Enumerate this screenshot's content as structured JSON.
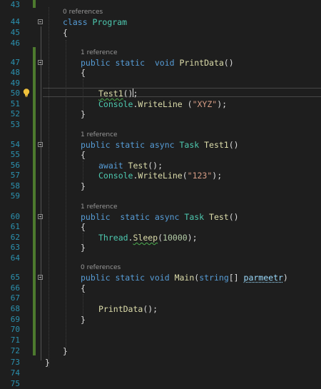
{
  "editor": {
    "colors": {
      "keyword": "#569cd6",
      "type": "#4ec9b0",
      "method": "#dcdcaa",
      "string": "#d69d85",
      "number": "#b5cea8",
      "parameter": "#9cdcfe",
      "line_number": "#2b91af",
      "change_bar": "#4d7a2e"
    },
    "code_lens": {
      "program": "0 references",
      "printdata": "1 reference",
      "test1": "1 reference",
      "test": "1 reference",
      "main": "0 references"
    },
    "lines": [
      {
        "num": "43",
        "tokens": []
      },
      {
        "num": "44",
        "tokens": [
          [
            "kw",
            "class "
          ],
          [
            "type",
            "Program"
          ]
        ]
      },
      {
        "num": "45",
        "tokens": [
          [
            "plain",
            "{"
          ]
        ]
      },
      {
        "num": "46",
        "tokens": []
      },
      {
        "num": "47",
        "tokens": [
          [
            "kw",
            "public static  void "
          ],
          [
            "method",
            "PrintData"
          ],
          [
            "plain",
            "()"
          ]
        ]
      },
      {
        "num": "48",
        "tokens": [
          [
            "plain",
            "{"
          ]
        ]
      },
      {
        "num": "49",
        "tokens": []
      },
      {
        "num": "50",
        "tokens": [
          [
            "method",
            "Test1"
          ],
          [
            "plain",
            "();"
          ]
        ]
      },
      {
        "num": "51",
        "tokens": [
          [
            "type",
            "Console"
          ],
          [
            "plain",
            "."
          ],
          [
            "method",
            "WriteLine"
          ],
          [
            "plain",
            " ("
          ],
          [
            "str",
            "\"XYZ\""
          ],
          [
            "plain",
            ");"
          ]
        ]
      },
      {
        "num": "52",
        "tokens": [
          [
            "plain",
            "}"
          ]
        ]
      },
      {
        "num": "53",
        "tokens": []
      },
      {
        "num": "54",
        "tokens": [
          [
            "kw",
            "public static async "
          ],
          [
            "type",
            "Task "
          ],
          [
            "method",
            "Test1"
          ],
          [
            "plain",
            "()"
          ]
        ]
      },
      {
        "num": "55",
        "tokens": [
          [
            "plain",
            "{"
          ]
        ]
      },
      {
        "num": "56",
        "tokens": [
          [
            "kw",
            "await "
          ],
          [
            "method",
            "Test"
          ],
          [
            "plain",
            "();"
          ]
        ]
      },
      {
        "num": "57",
        "tokens": [
          [
            "type",
            "Console"
          ],
          [
            "plain",
            "."
          ],
          [
            "method",
            "WriteLine"
          ],
          [
            "plain",
            "("
          ],
          [
            "str",
            "\"123\""
          ],
          [
            "plain",
            ");"
          ]
        ]
      },
      {
        "num": "58",
        "tokens": [
          [
            "plain",
            "}"
          ]
        ]
      },
      {
        "num": "59",
        "tokens": []
      },
      {
        "num": "60",
        "tokens": [
          [
            "kw",
            "public  static async "
          ],
          [
            "type",
            "Task "
          ],
          [
            "method",
            "Test"
          ],
          [
            "plain",
            "()"
          ]
        ]
      },
      {
        "num": "61",
        "tokens": [
          [
            "plain",
            "{"
          ]
        ]
      },
      {
        "num": "62",
        "tokens": [
          [
            "type",
            "Thread"
          ],
          [
            "plain",
            "."
          ],
          [
            "method",
            "Sleep"
          ],
          [
            "plain",
            "("
          ],
          [
            "num",
            "10000"
          ],
          [
            "plain",
            ");"
          ]
        ]
      },
      {
        "num": "63",
        "tokens": [
          [
            "plain",
            "}"
          ]
        ]
      },
      {
        "num": "64",
        "tokens": []
      },
      {
        "num": "65",
        "tokens": [
          [
            "kw",
            "public static void "
          ],
          [
            "method",
            "Main"
          ],
          [
            "plain",
            "("
          ],
          [
            "kw",
            "string"
          ],
          [
            "plain",
            "[] "
          ],
          [
            "param",
            "parmeetr"
          ],
          [
            "plain",
            ")"
          ]
        ]
      },
      {
        "num": "66",
        "tokens": [
          [
            "plain",
            "{"
          ]
        ]
      },
      {
        "num": "67",
        "tokens": []
      },
      {
        "num": "68",
        "tokens": [
          [
            "method",
            "PrintData"
          ],
          [
            "plain",
            "();"
          ]
        ]
      },
      {
        "num": "69",
        "tokens": [
          [
            "plain",
            "}"
          ]
        ]
      },
      {
        "num": "70",
        "tokens": []
      },
      {
        "num": "71",
        "tokens": []
      },
      {
        "num": "72",
        "tokens": [
          [
            "plain",
            "}"
          ]
        ]
      },
      {
        "num": "73",
        "tokens": [
          [
            "plain",
            "}"
          ]
        ]
      },
      {
        "num": "74",
        "tokens": []
      },
      {
        "num": "75",
        "tokens": []
      }
    ]
  }
}
